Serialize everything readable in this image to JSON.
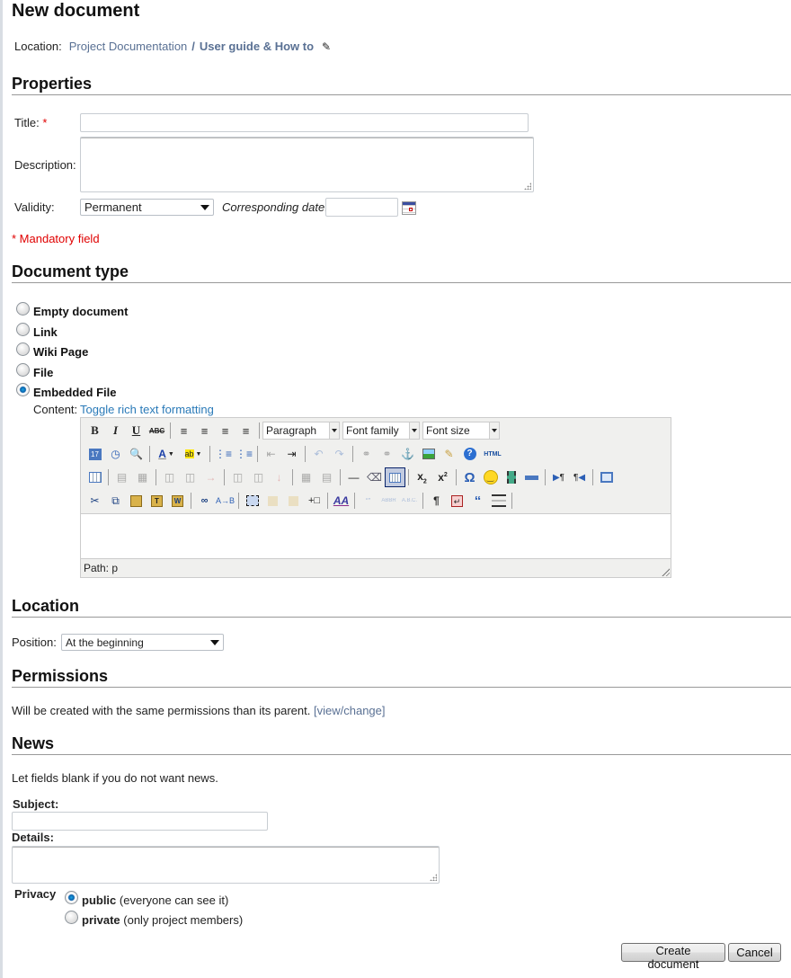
{
  "page_title": "New document",
  "breadcrumb": {
    "label": "Location:",
    "parent": "Project Documentation",
    "separator": "/",
    "current": "User guide & How to",
    "edit_icon": "pencil-icon"
  },
  "properties": {
    "heading": "Properties",
    "title_label": "Title:",
    "required_mark": "*",
    "title_value": "",
    "description_label": "Description:",
    "description_value": "",
    "validity_label": "Validity:",
    "validity_value": "Permanent",
    "date_label": "Corresponding date:",
    "date_value": "",
    "calendar_icon": "calendar-icon",
    "mandatory_note": "* Mandatory field"
  },
  "document_type": {
    "heading": "Document type",
    "options": [
      {
        "label": "Empty document",
        "checked": false
      },
      {
        "label": "Link",
        "checked": false
      },
      {
        "label": "Wiki Page",
        "checked": false
      },
      {
        "label": "File",
        "checked": false
      },
      {
        "label": "Embedded File",
        "checked": true
      }
    ],
    "content_label": "Content:",
    "toggle_link": "Toggle rich text formatting"
  },
  "editor": {
    "format_select": "Paragraph",
    "font_family_select": "Font family",
    "font_size_select": "Font size",
    "path": "Path: p",
    "html_label": "HTML"
  },
  "location": {
    "heading": "Location",
    "position_label": "Position:",
    "position_value": "At the beginning"
  },
  "permissions": {
    "heading": "Permissions",
    "text": "Will be created with the same permissions than its parent.",
    "link": "[view/change]"
  },
  "news": {
    "heading": "News",
    "hint": "Let fields blank if you do not want news.",
    "subject_label": "Subject:",
    "subject_value": "",
    "details_label": "Details:",
    "details_value": "",
    "privacy_label": "Privacy",
    "privacy_options": [
      {
        "label": "public",
        "note": "(everyone can see it)",
        "checked": true
      },
      {
        "label": "private",
        "note": "(only project members)",
        "checked": false
      }
    ]
  },
  "actions": {
    "create": "Create document",
    "cancel": "Cancel"
  },
  "colors": {
    "link": "#5a7194",
    "link_blue": "#2a7ab8",
    "required": "#e00000"
  }
}
